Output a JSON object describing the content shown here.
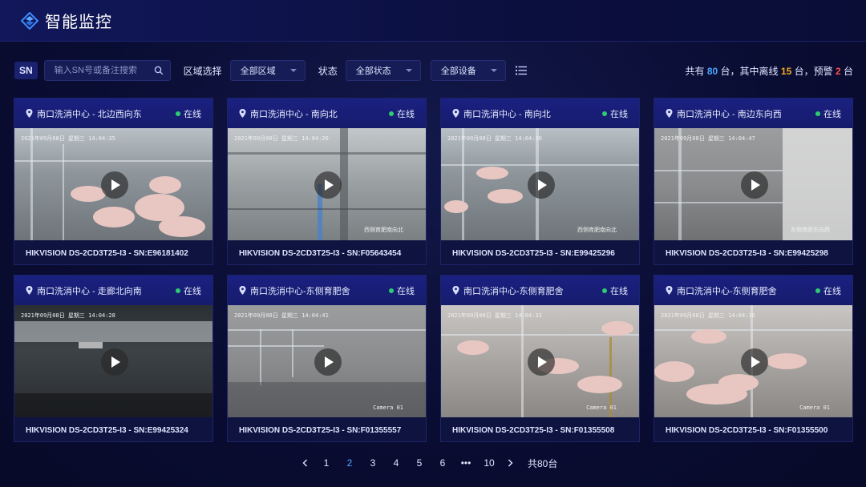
{
  "app": {
    "title": "智能监控",
    "logo_icon": "layered-diamond-logo-icon"
  },
  "toolbar": {
    "sn_tag": "SN",
    "search_placeholder": "输入SN号或备注搜索",
    "region_label": "区域选择",
    "region_value": "全部区域",
    "status_label": "状态",
    "status_value": "全部状态",
    "device_value": "全部设备",
    "summary": {
      "prefix": "共有",
      "total": "80",
      "mid1": "台，其中离线",
      "offline": "15",
      "mid2": "台，预警",
      "warning": "2",
      "suffix": "台"
    }
  },
  "colors": {
    "accent": "#4ca6ff",
    "offline": "#f5a623",
    "warning": "#ff4d4f",
    "online_dot": "#2ecc71",
    "card_header": "#1a2080"
  },
  "cameras": [
    {
      "location": "南口洗消中心 - 北边西向东",
      "status": "在线",
      "timestamp": "2021年09月08日  星期三  14:04:35",
      "caption": "",
      "sn": "HIKVISION DS-2CD3T25-I3 - SN:E96181402"
    },
    {
      "location": "南口洗消中心 - 南向北",
      "status": "在线",
      "timestamp": "2021年09月08日  星期三  14:04:26",
      "caption": "西侧育肥南向北",
      "sn": "HIKVISION DS-2CD3T25-I3 - SN:F05643454"
    },
    {
      "location": "南口洗消中心 - 南向北",
      "status": "在线",
      "timestamp": "2021年09月08日  星期三  14:04:30",
      "caption": "西侧育肥南向北",
      "sn": "HIKVISION DS-2CD3T25-I3 - SN:E99425296"
    },
    {
      "location": "南口洗消中心 - 南边东向西",
      "status": "在线",
      "timestamp": "2021年09月08日  星期三  14:04:47",
      "caption": "东侧育肥东向西",
      "sn": "HIKVISION DS-2CD3T25-I3 - SN:E99425298"
    },
    {
      "location": "南口洗消中心 - 走廊北向南",
      "status": "在线",
      "timestamp": "2021年09月08日  星期三  14:04:28",
      "caption": "",
      "sn": "HIKVISION DS-2CD3T25-I3 - SN:E99425324"
    },
    {
      "location": "南口洗消中心-东侧育肥舍",
      "status": "在线",
      "timestamp": "2021年09月08日  星期三  14:04:41",
      "caption": "Camera 01",
      "sn": "HIKVISION DS-2CD3T25-I3 - SN:F01355557"
    },
    {
      "location": "南口洗消中心-东侧育肥舍",
      "status": "在线",
      "timestamp": "2021年09月08日  星期三  14:04:32",
      "caption": "Camera 01",
      "sn": "HIKVISION DS-2CD3T25-I3 - SN:F01355508"
    },
    {
      "location": "南口洗消中心-东侧育肥舍",
      "status": "在线",
      "timestamp": "2021年09月08日  星期三  14:04:36",
      "caption": "Camera 01",
      "sn": "HIKVISION DS-2CD3T25-I3 - SN:F01355500"
    }
  ],
  "pagination": {
    "pages": [
      "1",
      "2",
      "3",
      "4",
      "5",
      "6",
      "•••",
      "10"
    ],
    "current": "2",
    "total_label": "共80台",
    "prev_icon": "chevron-left-icon",
    "next_icon": "chevron-right-icon"
  }
}
